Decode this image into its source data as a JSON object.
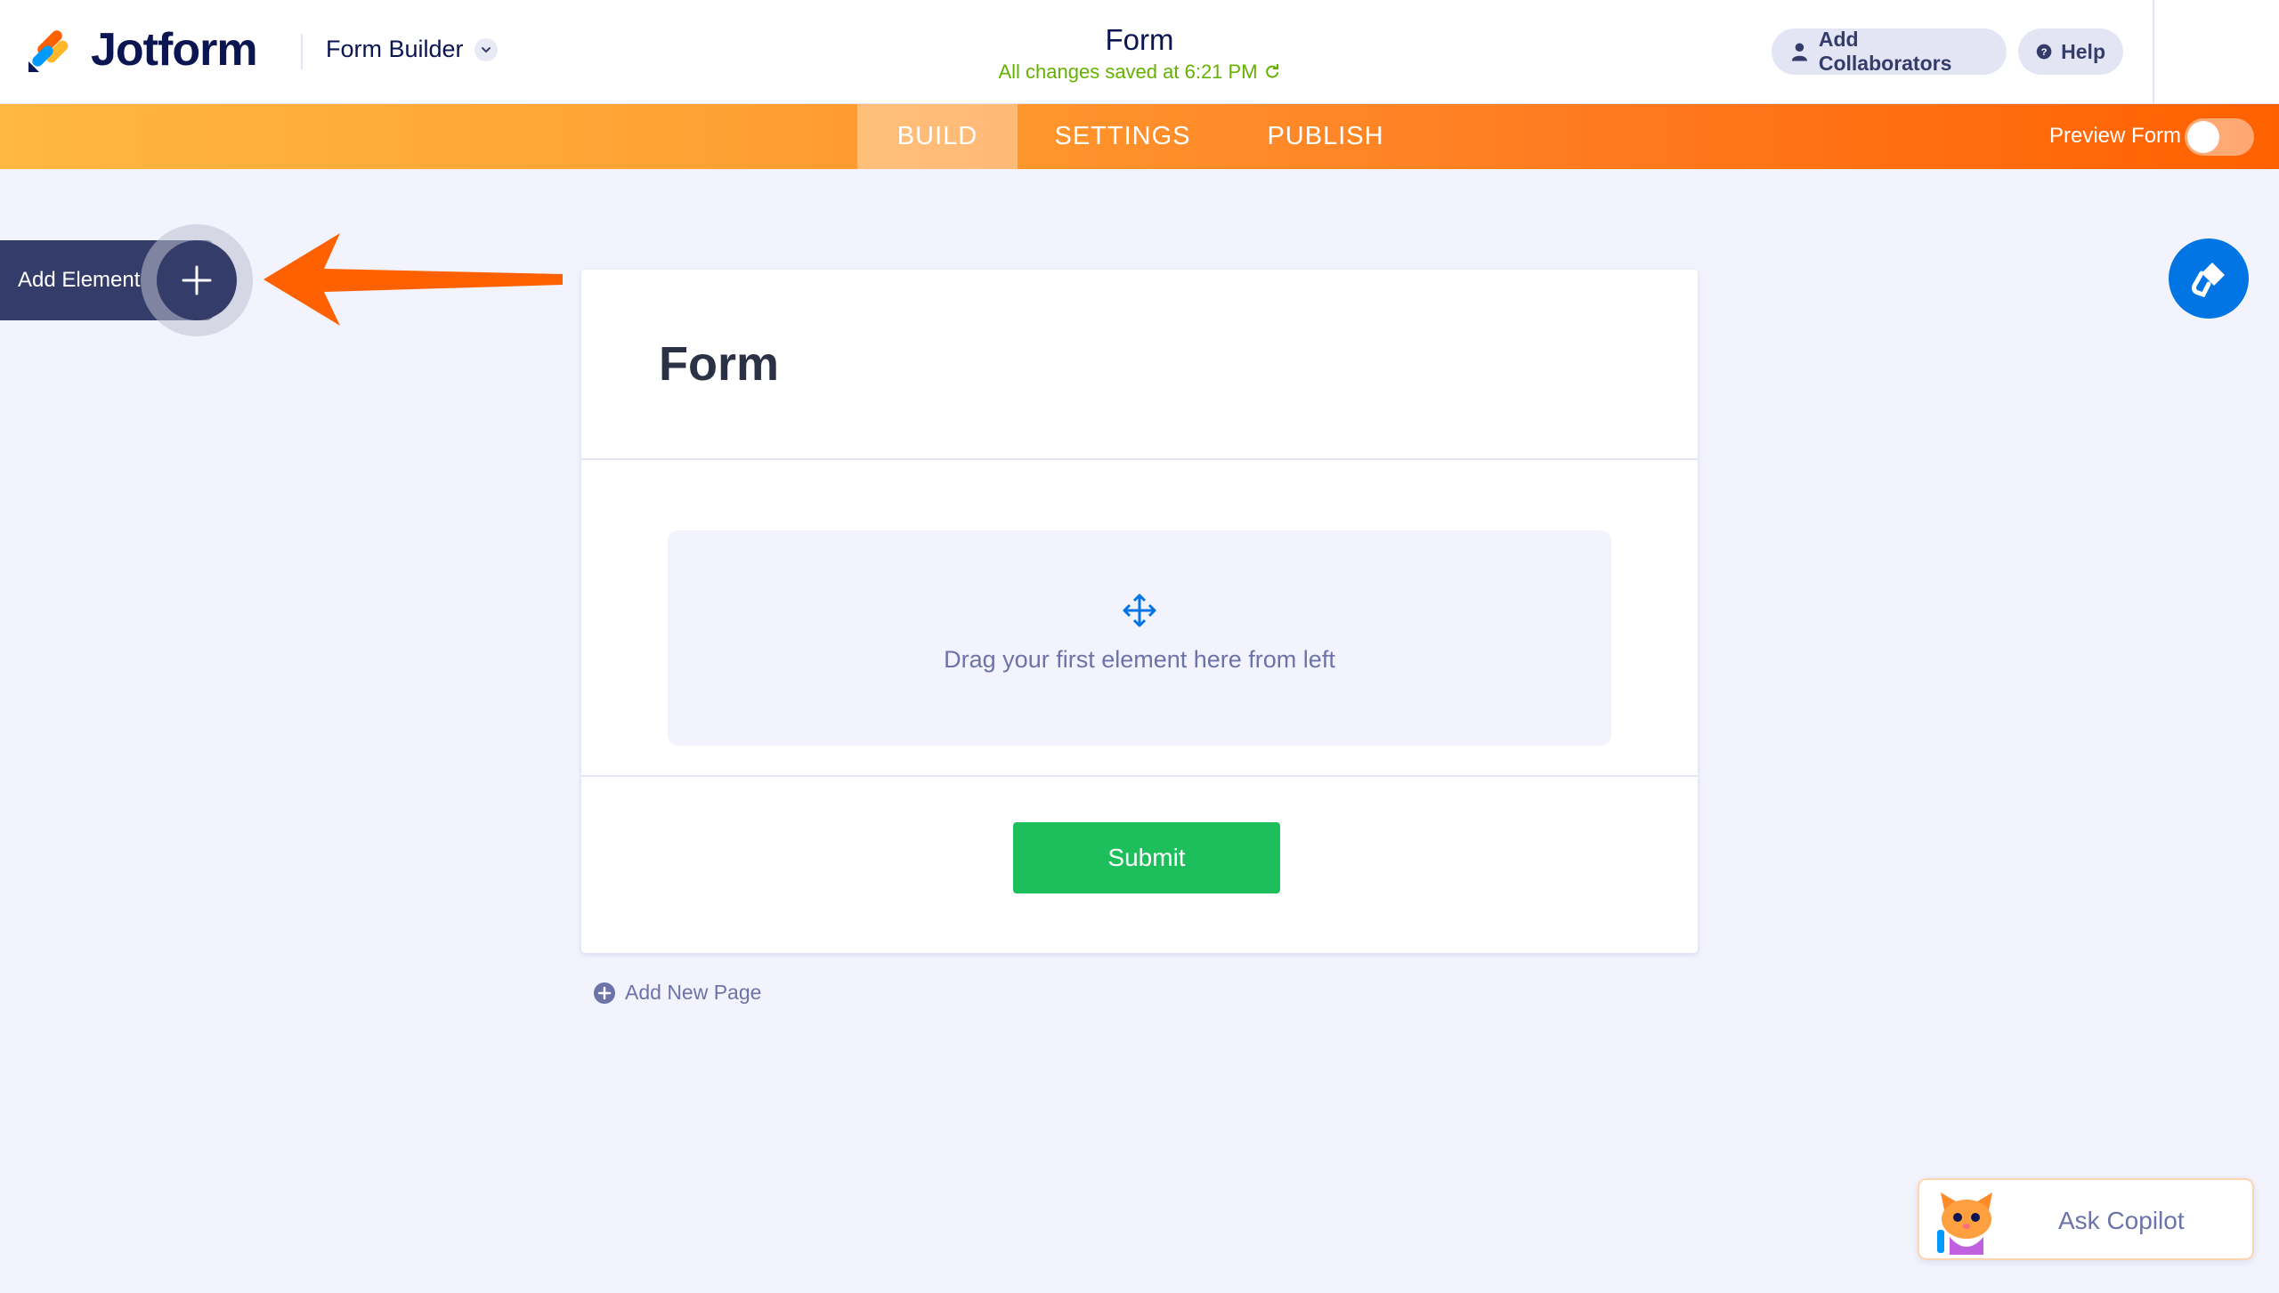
{
  "app": {
    "logo_text": "Jotform",
    "builder_label": "Form Builder"
  },
  "header": {
    "form_title": "Form",
    "save_status": "All changes saved at 6:21 PM",
    "collaborators_label": "Add Collaborators",
    "help_label": "Help"
  },
  "nav": {
    "tabs": [
      {
        "label": "BUILD",
        "active": true
      },
      {
        "label": "SETTINGS",
        "active": false
      },
      {
        "label": "PUBLISH",
        "active": false
      }
    ],
    "preview_label": "Preview Form",
    "preview_on": false
  },
  "sidebar": {
    "add_element_label": "Add Element"
  },
  "form": {
    "heading": "Form",
    "drop_zone_text": "Drag your first element here from left",
    "submit_label": "Submit",
    "add_page_label": "Add New Page"
  },
  "copilot": {
    "label": "Ask Copilot"
  },
  "icons": {
    "logo": "jotform-logo-icon",
    "chevron": "chevron-down-icon",
    "refresh": "refresh-icon",
    "user": "user-icon",
    "help": "help-icon",
    "plus": "plus-icon",
    "arrow": "pointer-arrow-icon",
    "paint": "paint-roller-icon",
    "move": "move-icon",
    "add_circle": "plus-circle-icon",
    "mascot": "copilot-mascot-icon"
  },
  "colors": {
    "accent_orange": "#FF6100",
    "submit_green": "#1DBF5C",
    "designer_blue": "#0075E3",
    "navy": "#0A1551",
    "save_green": "#64B200"
  }
}
